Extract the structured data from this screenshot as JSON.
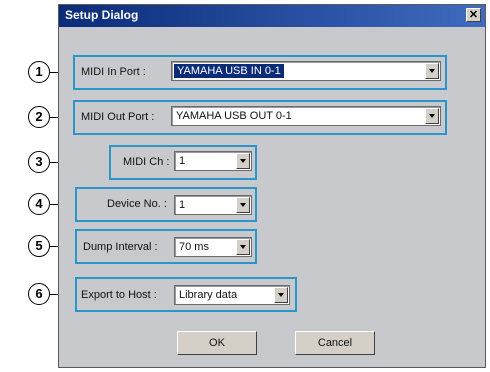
{
  "window": {
    "title": "Setup Dialog",
    "close_glyph": "✕"
  },
  "rows": [
    {
      "num": "1",
      "label": "MIDI In Port :",
      "value": "YAMAHA USB IN 0-1"
    },
    {
      "num": "2",
      "label": "MIDI Out Port :",
      "value": "YAMAHA USB OUT 0-1"
    },
    {
      "num": "3",
      "label": "MIDI Ch :",
      "value": "1"
    },
    {
      "num": "4",
      "label": "Device No. :",
      "value": "1"
    },
    {
      "num": "5",
      "label": "Dump Interval :",
      "value": "70 ms"
    },
    {
      "num": "6",
      "label": "Export to Host :",
      "value": "Library data"
    }
  ],
  "buttons": {
    "ok": "OK",
    "cancel": "Cancel"
  },
  "colors": {
    "highlight_box": "#2a95c9",
    "title_bar": "#0a2b78",
    "dialog_bg": "#c8c9cc"
  }
}
